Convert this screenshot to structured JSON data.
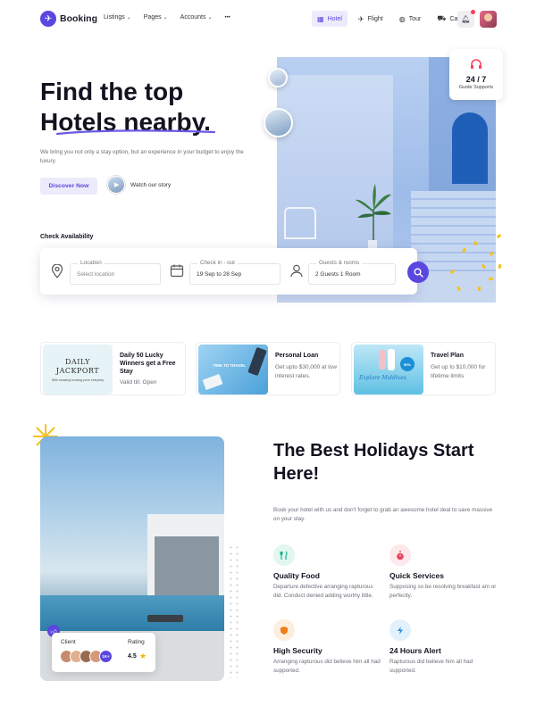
{
  "nav": {
    "brand": "Booking",
    "menu": [
      {
        "label": "Listings"
      },
      {
        "label": "Pages"
      },
      {
        "label": "Accounts"
      }
    ],
    "more": "•••",
    "categories": [
      {
        "label": "Hotel",
        "icon": "hotel-icon",
        "active": true
      },
      {
        "label": "Flight",
        "icon": "plane-icon",
        "active": false
      },
      {
        "label": "Tour",
        "icon": "globe-icon",
        "active": false
      },
      {
        "label": "Cab",
        "icon": "car-icon",
        "active": false
      }
    ]
  },
  "hero": {
    "title_line1": "Find the top",
    "title_line2": "Hotels nearby.",
    "subtitle": "We bring you not only a stay option, but an experience in your budget to enjoy the luxury.",
    "cta": "Discover Now",
    "watch_label": "Watch our story",
    "support_number": "24 / 7",
    "support_label": "Guide Supports"
  },
  "search": {
    "heading": "Check Availability",
    "location_label": "Location",
    "location_placeholder": "Select location",
    "checkin_label": "Check in - out",
    "checkin_value": "19 Sep to 28 Sep",
    "guests_label": "Guests & rooms",
    "guests_value": "2 Guests 1 Room"
  },
  "promos": [
    {
      "title": "Daily 50 Lucky Winners get a Free Stay",
      "desc": "Valid till: Open",
      "image_text": "DAILY JACKPORT",
      "image_small": "With amazing booking price everyday"
    },
    {
      "title": "Personal Loan",
      "desc": "Get upto $30,000 at low interest rates.",
      "image_text": "TIME TO TRAVEL"
    },
    {
      "title": "Travel Plan",
      "desc": "Get up to $10,000 for lifetime limits",
      "image_text": "Explore Maldives",
      "image_badge": "50%"
    }
  ],
  "section2": {
    "title": "The Best Holidays Start Here!",
    "desc": "Book your hotel with us and don't forget to grab an awesome hotel deal to save massive on your stay.",
    "rating_card": {
      "client_label": "Client",
      "rating_label": "Rating",
      "more": "1K+",
      "score": "4.5"
    },
    "features": [
      {
        "title": "Quality Food",
        "desc": "Departure defective arranging rapturous did. Conduct denied adding worthy little.",
        "icon": "utensils-icon",
        "color": "#1bb394",
        "bg": "#e3f6f0"
      },
      {
        "title": "Quick Services",
        "desc": "Supposing so be resolving breakfast am or perfectly.",
        "icon": "timer-icon",
        "color": "#e8455e",
        "bg": "#fde8eb"
      },
      {
        "title": "High Security",
        "desc": "Arranging rapturous did believe him all had supported.",
        "icon": "shield-icon",
        "color": "#f07d1a",
        "bg": "#fdeedd"
      },
      {
        "title": "24 Hours Alert",
        "desc": "Rapturous did believe him all had supported.",
        "icon": "bolt-icon",
        "color": "#1b8fd6",
        "bg": "#e2f1fb"
      }
    ]
  },
  "colors": {
    "accent": "#5b47e0",
    "accent_soft": "#ecebfb",
    "star": "#f5b400",
    "confetti": "#f5c21b"
  }
}
